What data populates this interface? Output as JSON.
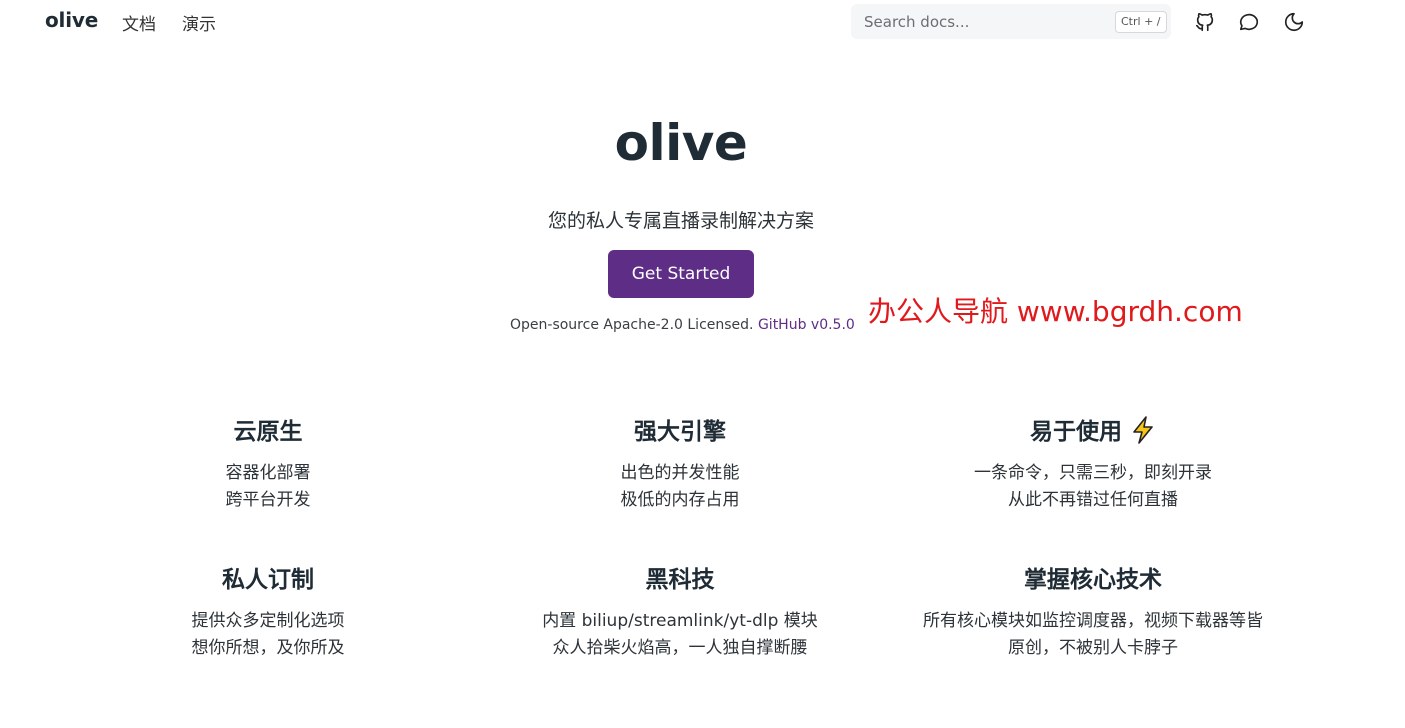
{
  "nav": {
    "brand": "olive",
    "links": [
      "文档",
      "演示"
    ],
    "search_placeholder": "Search docs...",
    "search_shortcut": "Ctrl + /",
    "icons": [
      "github-icon",
      "chat-icon",
      "moon-icon"
    ]
  },
  "hero": {
    "title": "olive",
    "subtitle": "您的私人专属直播录制解决方案",
    "cta_label": "Get Started",
    "license_text": "Open-source Apache-2.0 Licensed.",
    "github_link": "GitHub v0.5.0"
  },
  "watermark": "办公人导航 www.bgrdh.com",
  "features": [
    {
      "title": "云原生",
      "lines": [
        "容器化部署",
        "跨平台开发"
      ]
    },
    {
      "title": "强大引擎",
      "lines": [
        "出色的并发性能",
        "极低的内存占用"
      ]
    },
    {
      "title": "易于使用",
      "icon": "lightning-icon",
      "lines": [
        "一条命令，只需三秒，即刻开录",
        "从此不再错过任何直播"
      ]
    },
    {
      "title": "私人订制",
      "lines": [
        "提供众多定制化选项",
        "想你所想，及你所及"
      ]
    },
    {
      "title": "黑科技",
      "lines": [
        "内置 biliup/streamlink/yt-dlp 模块",
        "众人拾柴火焰高，一人独自撑断腰"
      ]
    },
    {
      "title": "掌握核心技术",
      "lines": [
        "所有核心模块如监控调度器，视频下载器等皆",
        "原创，不被别人卡脖子"
      ]
    }
  ],
  "colors": {
    "accent": "#5e2d86",
    "text_dark": "#1f2b35",
    "watermark": "#e0191d",
    "bolt": "#f5c518"
  }
}
